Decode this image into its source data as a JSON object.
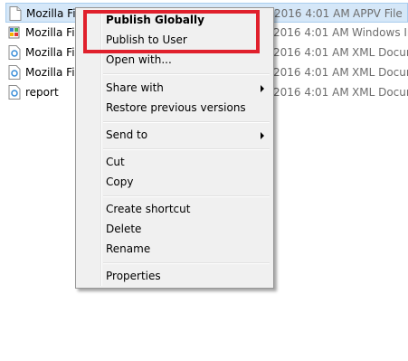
{
  "files": [
    {
      "name": "Mozilla Fir",
      "date": "2016 4:01 AM",
      "type": "APPV File",
      "icon": "appv-file-icon"
    },
    {
      "name": "Mozilla Fir",
      "date": "2016 4:01 AM",
      "type": "Windows Ins",
      "icon": "windows-installer-icon"
    },
    {
      "name": "Mozilla Fir",
      "date": "2016 4:01 AM",
      "type": "XML Docum",
      "icon": "xml-document-icon"
    },
    {
      "name": "Mozilla Fir",
      "date": "2016 4:01 AM",
      "type": "XML Docum",
      "icon": "xml-document-icon"
    },
    {
      "name": "report",
      "date": "2016 4:01 AM",
      "type": "XML Docum",
      "icon": "xml-document-icon"
    }
  ],
  "menu": {
    "publish_globally": "Publish Globally",
    "publish_to_user": "Publish to User",
    "open_with": "Open with...",
    "share_with": "Share with",
    "restore_previous_versions": "Restore previous versions",
    "send_to": "Send to",
    "cut": "Cut",
    "copy": "Copy",
    "create_shortcut": "Create shortcut",
    "delete": "Delete",
    "rename": "Rename",
    "properties": "Properties"
  },
  "colors": {
    "highlight_border": "#e0202c",
    "selection": "#d5e7f8",
    "menu_background": "#f0f0f0"
  }
}
